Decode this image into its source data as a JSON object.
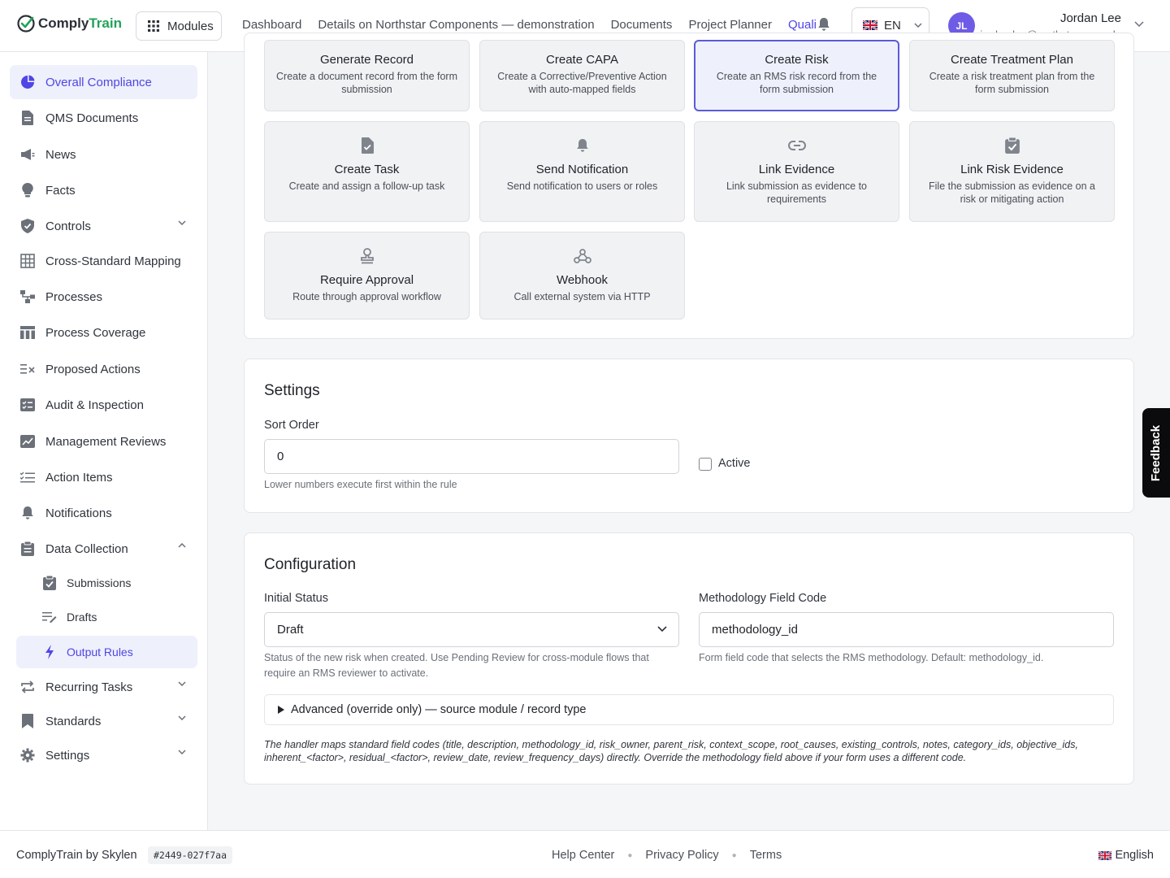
{
  "brand": {
    "name_part1": "Comply",
    "name_part2": "Train"
  },
  "header": {
    "modules_label": "Modules",
    "nav": [
      "Dashboard",
      "Details on Northstar Components — demonstration",
      "Documents",
      "Project Planner",
      "Quali"
    ],
    "language": "EN",
    "user": {
      "initials": "JL",
      "name": "Jordan Lee",
      "email": "jordan.lee@northstar.example"
    }
  },
  "sidebar": {
    "items": [
      {
        "label": "Overall Compliance"
      },
      {
        "label": "QMS Documents"
      },
      {
        "label": "News"
      },
      {
        "label": "Facts"
      },
      {
        "label": "Controls"
      },
      {
        "label": "Cross-Standard Mapping"
      },
      {
        "label": "Processes"
      },
      {
        "label": "Process Coverage"
      },
      {
        "label": "Proposed Actions"
      },
      {
        "label": "Audit & Inspection"
      },
      {
        "label": "Management Reviews"
      },
      {
        "label": "Action Items"
      },
      {
        "label": "Notifications"
      },
      {
        "label": "Data Collection"
      },
      {
        "label": "Recurring Tasks"
      },
      {
        "label": "Standards"
      },
      {
        "label": "Settings"
      }
    ],
    "sub_items": [
      {
        "label": "Submissions"
      },
      {
        "label": "Drafts"
      },
      {
        "label": "Output Rules"
      }
    ]
  },
  "actions": [
    {
      "title": "Generate Record",
      "desc": "Create a document record from the form submission"
    },
    {
      "title": "Create CAPA",
      "desc": "Create a Corrective/Preventive Action with auto-mapped fields"
    },
    {
      "title": "Create Risk",
      "desc": "Create an RMS risk record from the form submission"
    },
    {
      "title": "Create Treatment Plan",
      "desc": "Create a risk treatment plan from the form submission"
    },
    {
      "title": "Create Task",
      "desc": "Create and assign a follow-up task"
    },
    {
      "title": "Send Notification",
      "desc": "Send notification to users or roles"
    },
    {
      "title": "Link Evidence",
      "desc": "Link submission as evidence to requirements"
    },
    {
      "title": "Link Risk Evidence",
      "desc": "File the submission as evidence on a risk or mitigating action"
    },
    {
      "title": "Require Approval",
      "desc": "Route through approval workflow"
    },
    {
      "title": "Webhook",
      "desc": "Call external system via HTTP"
    }
  ],
  "settings": {
    "title": "Settings",
    "sort_order_label": "Sort Order",
    "sort_order_value": "0",
    "sort_order_hint": "Lower numbers execute first within the rule",
    "active_label": "Active"
  },
  "configuration": {
    "title": "Configuration",
    "initial_status_label": "Initial Status",
    "initial_status_value": "Draft",
    "initial_status_hint": "Status of the new risk when created. Use Pending Review for cross-module flows that require an RMS reviewer to activate.",
    "methodology_label": "Methodology Field Code",
    "methodology_value": "methodology_id",
    "methodology_hint": "Form field code that selects the RMS methodology. Default: methodology_id.",
    "advanced_label": "Advanced (override only) — source module / record type",
    "note": "The handler maps standard field codes (title, description, methodology_id, risk_owner, parent_risk, context_scope, root_causes, existing_controls, notes, category_ids, objective_ids, inherent_<factor>, residual_<factor>, review_date, review_frequency_days) directly. Override the methodology field above if your form uses a different code."
  },
  "feedback_label": "Feedback",
  "footer": {
    "brand": "ComplyTrain by Skylen",
    "build": "#2449-027f7aa",
    "links": [
      "Help Center",
      "Privacy Policy",
      "Terms"
    ],
    "language": "English"
  }
}
